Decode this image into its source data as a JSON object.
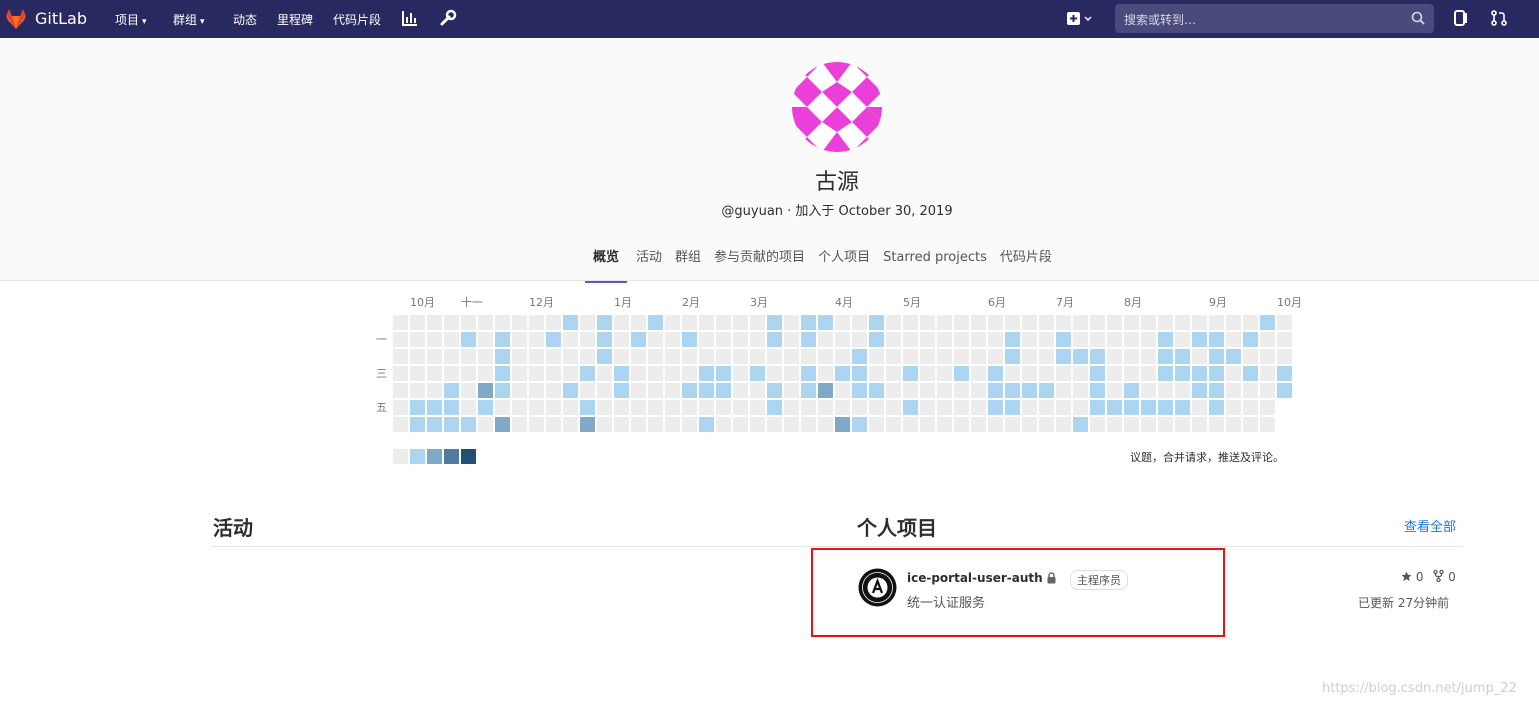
{
  "nav": {
    "brand": "GitLab",
    "items": [
      {
        "label": "项目",
        "caret": true
      },
      {
        "label": "群组",
        "caret": true
      },
      {
        "label": "动态",
        "caret": false
      },
      {
        "label": "里程碑",
        "caret": false
      },
      {
        "label": "代码片段",
        "caret": false
      }
    ],
    "search_placeholder": "搜索或转到…",
    "icons": [
      "chart-icon",
      "wrench-icon",
      "plus-icon",
      "todo-icon",
      "merge-request-icon",
      "search-icon"
    ],
    "colors": {
      "bar": "#292961",
      "accent": "#6b4fbb",
      "link": "#1f78d1"
    }
  },
  "profile": {
    "name": "古源",
    "meta": "@guyuan  ·  加入于 October 30, 2019",
    "tabs": [
      "概览",
      "活动",
      "群组",
      "参与贡献的项目",
      "个人项目",
      "Starred projects",
      "代码片段"
    ],
    "active_tab": 0
  },
  "calendar": {
    "months": [
      "10月",
      "十一",
      "12月",
      "1月",
      "2月",
      "3月",
      "4月",
      "5月",
      "6月",
      "7月",
      "8月",
      "9月",
      "10月"
    ],
    "days": [
      "一",
      "三",
      "五"
    ],
    "legend": "议题，合并请求，推送及评论。",
    "legend_colors": [
      "#ededed",
      "#acd5f2",
      "#7fa8c9",
      "#527ba0",
      "#254e77"
    ]
  },
  "activity": {
    "title": "活动"
  },
  "personal_projects": {
    "title": "个人项目",
    "view_all": "查看全部",
    "items": [
      {
        "name": "ice-portal-user-auth",
        "role": "主程序员",
        "description": "统一认证服务",
        "stars": "0",
        "forks": "0",
        "updated": "已更新 27分钟前"
      }
    ]
  },
  "watermark": "https://blog.csdn.net/jump_22"
}
